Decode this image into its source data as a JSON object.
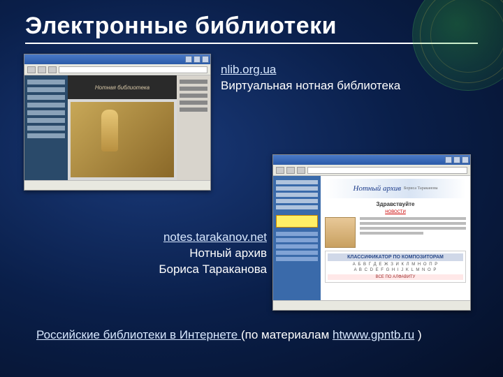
{
  "title": "Электронные библиотеки",
  "item1": {
    "link": "nlib.org.ua",
    "desc": "Виртуальная нотная библиотека",
    "banner": "Нотная библиотека"
  },
  "item2": {
    "link": "notes.tarakanov.net",
    "desc1": "Нотный архив",
    "desc2": "Бориса Тараканова",
    "logo_main": "Нотный архив",
    "logo_sub": "Бориса Тараканова",
    "hello": "Здравствуйте",
    "news": "НОВОСТИ",
    "klass_header": "КЛАССИФИКАТОР ПО КОМПОЗИТОРАМ",
    "alpha": "А Б В Г Д Е Ж З И К Л М Н О П Р",
    "alpha2": "A B C D E F G H I J K L M N O P",
    "bottom": "ВСЕ ПО АЛФАВИТУ"
  },
  "footer": {
    "t1": "Российские библиотеки в Интернете ",
    "t2": "(по материалам ",
    "t3": "htwww.gpntb.ru",
    "t4": " )"
  }
}
